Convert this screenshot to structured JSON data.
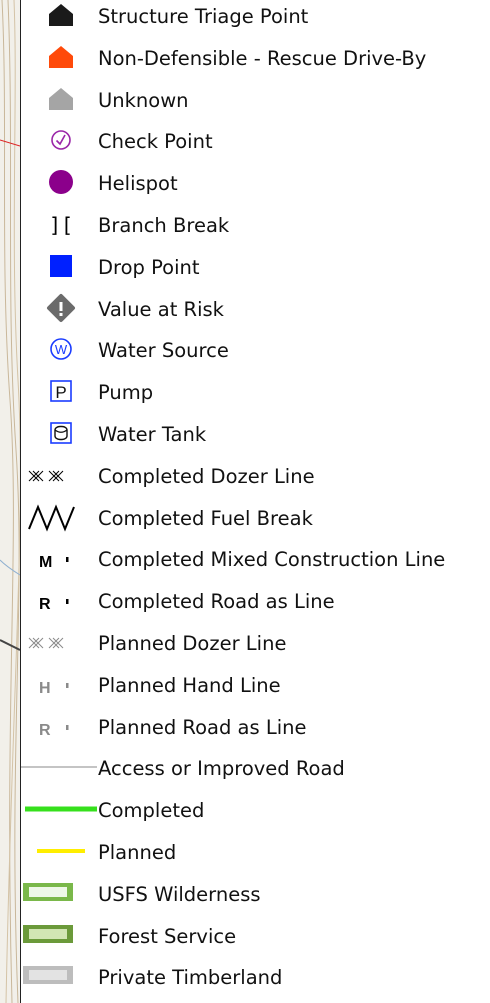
{
  "legend_items": [
    {
      "label": "Structure Triage Point",
      "icon": "house-black-icon",
      "color": "#1a1a1a"
    },
    {
      "label": "Non-Defensible - Rescue Drive-By",
      "icon": "house-orange-icon",
      "color": "#ff4a0a"
    },
    {
      "label": "Unknown",
      "icon": "house-gray-icon",
      "color": "#a5a5a5"
    },
    {
      "label": "Check Point",
      "icon": "check-circle-icon",
      "color": "#9a26a8"
    },
    {
      "label": "Helispot",
      "icon": "purple-dot-icon",
      "color": "#8b008b"
    },
    {
      "label": "Branch Break",
      "icon": "branch-break-icon",
      "color": "#000000"
    },
    {
      "label": "Drop Point",
      "icon": "blue-square-icon",
      "color": "#0020ff"
    },
    {
      "label": "Value at Risk",
      "icon": "value-at-risk-icon",
      "color": "#6b6b6b"
    },
    {
      "label": "Water Source",
      "icon": "water-source-icon",
      "color": "#1a3cff"
    },
    {
      "label": "Pump",
      "icon": "pump-icon",
      "color": "#1a3cff"
    },
    {
      "label": "Water Tank",
      "icon": "water-tank-icon",
      "color": "#1a3cff"
    },
    {
      "label": "Completed Dozer Line",
      "icon": "dozer-line-icon",
      "color": "#000000"
    },
    {
      "label": "Completed Fuel Break",
      "icon": "fuel-break-icon",
      "color": "#000000"
    },
    {
      "label": "Completed Mixed Construction Line",
      "icon": "mixed-line-icon",
      "color": "#000000",
      "symbol_text": "M"
    },
    {
      "label": "Completed Road as Line",
      "icon": "road-line-icon",
      "color": "#000000",
      "symbol_text": "R"
    },
    {
      "label": "Planned Dozer Line",
      "icon": "planned-dozer-line-icon",
      "color": "#8a8a8a"
    },
    {
      "label": "Planned Hand Line",
      "icon": "planned-hand-line-icon",
      "color": "#8a8a8a",
      "symbol_text": "H"
    },
    {
      "label": "Planned Road as Line",
      "icon": "planned-road-line-icon",
      "color": "#8a8a8a",
      "symbol_text": "R"
    },
    {
      "label": "Access or Improved Road",
      "icon": "road-line-thin-icon",
      "color": "#8a8a8a"
    },
    {
      "label": "Completed",
      "icon": "green-line-icon",
      "color": "#36e01c"
    },
    {
      "label": "Planned",
      "icon": "yellow-line-icon",
      "color": "#ffee00"
    },
    {
      "label": "USFS Wilderness",
      "icon": "wilderness-box-icon",
      "color": "#7ab84a"
    },
    {
      "label": "Forest Service",
      "icon": "forest-service-box-icon",
      "color": "#6b9a3a"
    },
    {
      "label": "Private Timberland",
      "icon": "private-timberland-box-icon",
      "color": "#bdbdbd"
    }
  ]
}
